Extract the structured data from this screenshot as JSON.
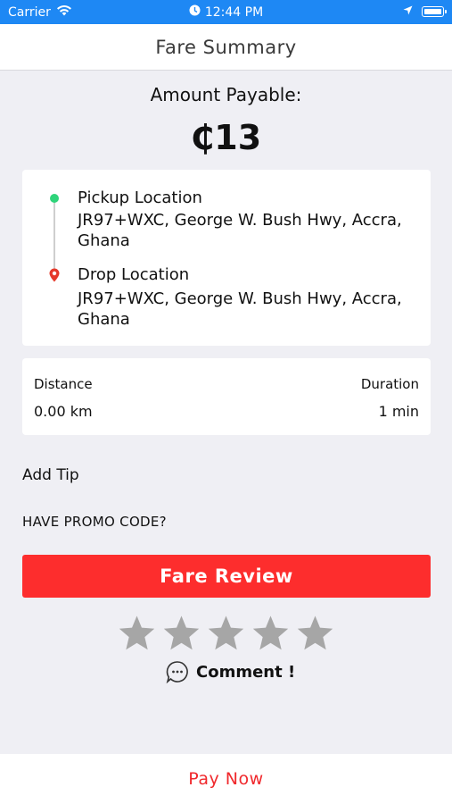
{
  "status_bar": {
    "carrier": "Carrier",
    "time": "12:44 PM"
  },
  "nav": {
    "title": "Fare Summary"
  },
  "fare": {
    "amount_label": "Amount Payable:",
    "amount_value": "₵13"
  },
  "route": {
    "pickup_label": "Pickup Location",
    "pickup_address": "JR97+WXC, George W. Bush Hwy, Accra, Ghana",
    "drop_label": "Drop Location",
    "drop_address": "JR97+WXC, George W. Bush Hwy, Accra, Ghana"
  },
  "trip_info": {
    "distance_label": "Distance",
    "distance_value": "0.00 km",
    "duration_label": "Duration",
    "duration_value": "1 min"
  },
  "actions": {
    "add_tip": "Add Tip",
    "promo_code": "HAVE PROMO CODE?",
    "fare_review": "Fare Review",
    "comment": "Comment !",
    "pay_now": "Pay Now"
  },
  "rating": {
    "max_stars": 5,
    "selected": 0
  },
  "colors": {
    "status_bar": "#1e88f4",
    "primary_red": "#fd2d2d",
    "pickup_green": "#2ed47a",
    "drop_red": "#e5392b",
    "star_gray": "#a6a6a6"
  }
}
